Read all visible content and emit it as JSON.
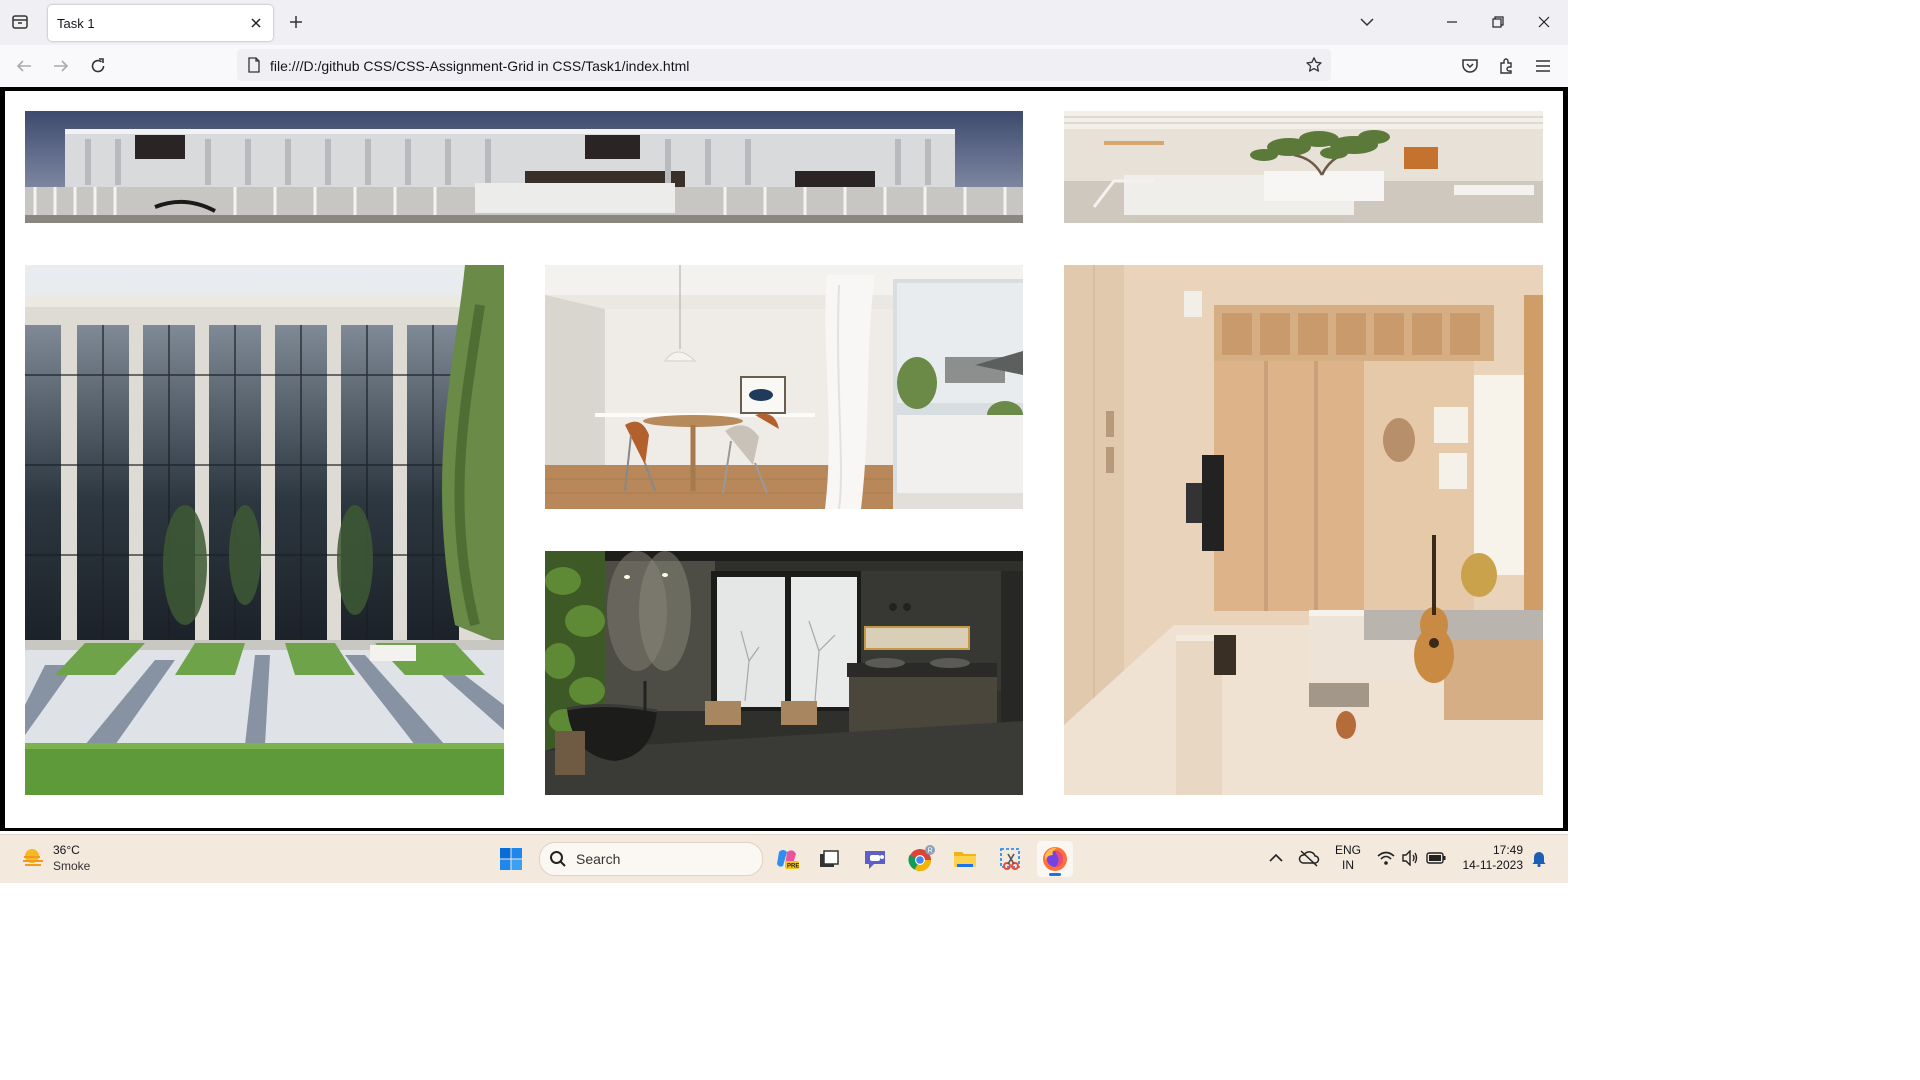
{
  "browser": {
    "tab": {
      "title": "Task 1"
    },
    "address": {
      "url": "file:///D:/github CSS/CSS-Assignment-Grid in CSS/Task1/index.html"
    }
  },
  "gallery": {
    "photos": [
      {
        "name": "modern-white-building-facade"
      },
      {
        "name": "minimal-living-room-with-tree"
      },
      {
        "name": "office-building-glass-columns"
      },
      {
        "name": "dining-room-round-table"
      },
      {
        "name": "wooden-studio-apartment"
      },
      {
        "name": "dark-bathroom-with-tub"
      }
    ]
  },
  "taskbar": {
    "weather": {
      "temp": "36°C",
      "desc": "Smoke"
    },
    "search": {
      "placeholder": "Search"
    },
    "language": {
      "line1": "ENG",
      "line2": "IN"
    },
    "clock": {
      "time": "17:49",
      "date": "14-11-2023"
    },
    "apps": [
      "windows-start",
      "search",
      "copilot",
      "task-view",
      "teams",
      "chrome",
      "file-explorer",
      "snipping-tool",
      "firefox"
    ],
    "accent": "#1a73e8"
  }
}
